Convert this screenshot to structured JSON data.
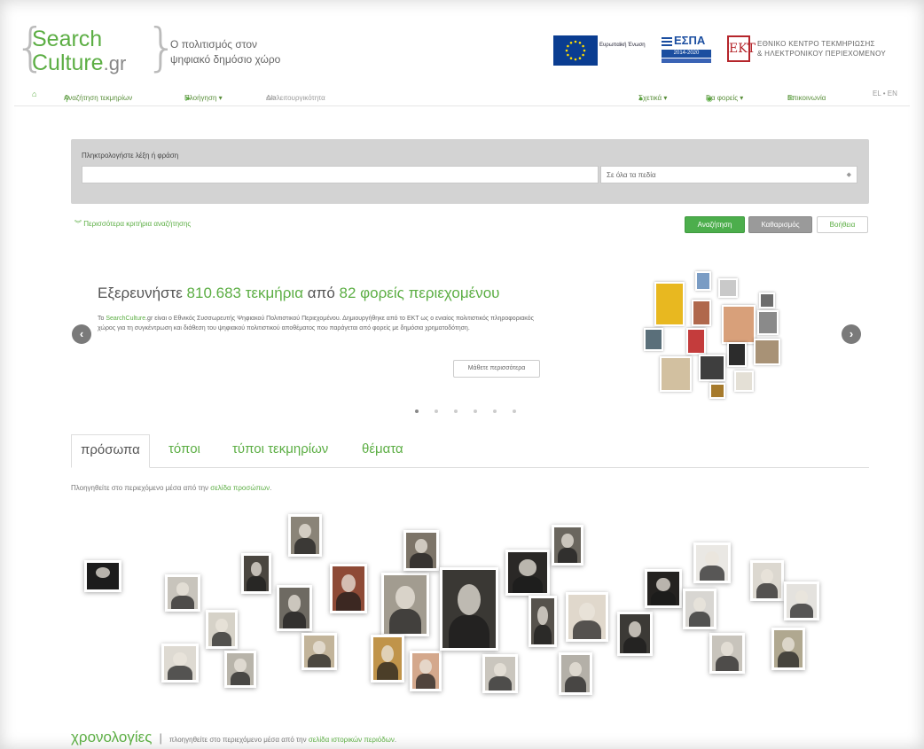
{
  "colors": {
    "accent": "#5cae44",
    "search_btn": "#4cae4c",
    "clear_btn": "#9a9a9a",
    "panel": "#d3d3d3",
    "ekt_red": "#b5252b",
    "eu_blue": "#0a3d91"
  },
  "logo": {
    "line1": "Search",
    "line2": "Culture",
    "suffix": ".gr"
  },
  "tagline": {
    "line1": "Ο πολιτισμός στον",
    "line2": "ψηφιακό δημόσιο χώρο"
  },
  "partners": {
    "eu_text": "Ευρωπαϊκή Ένωση",
    "espa_title": "ΕΣΠΑ",
    "espa_years": "2014-2020",
    "ekt_abbr": "ΕΚΤ",
    "ekt_line1": "ΕΘΝΙΚΟ ΚΕΝΤΡΟ ΤΕΚΜΗΡΙΩΣΗΣ",
    "ekt_line2": "& ΗΛΕΚΤΡΟΝΙΚΟΥ ΠΕΡΙΕΧΟΜΕΝΟΥ"
  },
  "nav": {
    "home_icon": "home-icon",
    "search": "Αναζήτηση τεκμηρίων",
    "browse": "Πλοήγηση ▾",
    "developers": "Διαλειτουργικότητα",
    "about": "Σχετικά ▾",
    "providers": "Για φορείς ▾",
    "contact": "Επικοινωνία",
    "lang": "EL • EN"
  },
  "search": {
    "label": "Πληκτρολογήστε λέξη ή φράση",
    "placeholder": "",
    "field_select": "Σε όλα τα πεδία",
    "more_criteria": "Περισσότερα κριτήρια αναζήτησης",
    "search_btn": "Αναζήτηση",
    "clear_btn": "Καθαρισμός",
    "help_btn": "Βοήθεια"
  },
  "hero": {
    "title_pre": "Εξερευνήστε ",
    "items_count": "810.683 τεκμήρια",
    "title_mid": " από ",
    "providers_count": "82 φορείς περιεχομένου",
    "text_link": "SearchCulture",
    "text_body": ".gr είναι ο Εθνικός Συσσωρευτής Ψηφιακού Πολιτιστικού Περιεχομένου. Δημιουργήθηκε από το ΕΚΤ ως ο ενιαίος πολιτιστικός πληροφοριακός χώρος για τη συγκέντρωση και διάθεση του ψηφιακού πολιτιστικού αποθέματος που παράγεται από φορείς με δημόσια χρηματοδότηση.",
    "text_prefix": "Το ",
    "learn_more": "Μάθετε περισσότερα",
    "prev_icon": "chevron-left-icon",
    "next_icon": "chevron-right-icon",
    "slide_count": 6,
    "active_slide": 1
  },
  "tabs": [
    {
      "label": "πρόσωπα",
      "active": true
    },
    {
      "label": "τόποι",
      "active": false
    },
    {
      "label": "τύποι τεκμηρίων",
      "active": false
    },
    {
      "label": "θέματα",
      "active": false
    }
  ],
  "persons_note": {
    "text": "Πλοηγηθείτε στο περιεχόμενο μέσα από την ",
    "link": "σελίδα προσώπων",
    "end": "."
  },
  "chrono": {
    "heading": "χρονολογίες",
    "sep": "|",
    "text": "πλοηγηθείτε στο περιεχόμενο μέσα από την ",
    "link": "σελίδα ιστορικών περιόδων",
    "end": "."
  }
}
